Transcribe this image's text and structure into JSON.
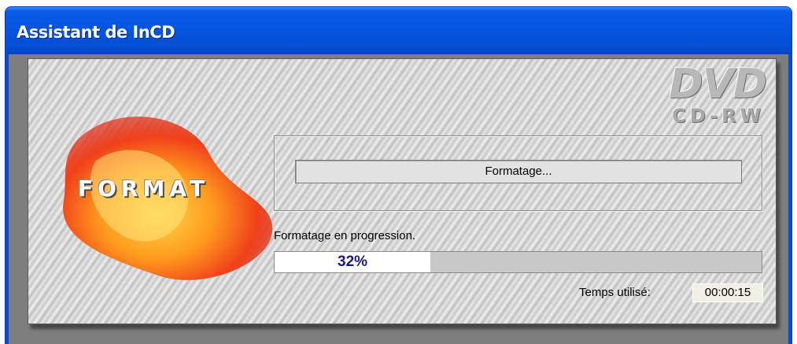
{
  "window": {
    "title": "Assistant de InCD"
  },
  "branding": {
    "dvd_logo": "DVD",
    "cdrw_logo": "CD-RW",
    "format_word": "FORMAT"
  },
  "status": {
    "box_text": "Formatage...",
    "progress_label": "Formatage en progression."
  },
  "progress": {
    "percent": 32,
    "text": "32%"
  },
  "time": {
    "label": "Temps utilisé:",
    "value": "00:00:15"
  },
  "colors": {
    "titlebar": "#0655e0",
    "progress_text": "#1a1a80"
  }
}
